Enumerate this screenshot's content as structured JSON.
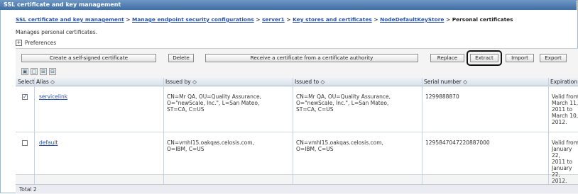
{
  "window": {
    "title": "SSL certificate and key management"
  },
  "breadcrumb": {
    "items": [
      "SSL certificate and key management",
      "Manage endpoint security configurations",
      "server1",
      "Key stores and certificates",
      "NodeDefaultKeyStore"
    ],
    "separator": ">",
    "current": "Personal certificates"
  },
  "description": "Manages personal certificates.",
  "preferences": {
    "label": "Preferences",
    "toggle": "+"
  },
  "toolbar": {
    "create": "Create a self-signed certificate",
    "delete": "Delete",
    "receive": "Receive a certificate from a certificate authority",
    "replace": "Replace",
    "extract": "Extract",
    "import": "Import",
    "export": "Export"
  },
  "table": {
    "headers": {
      "select": "Select",
      "alias": "Alias ◇",
      "issued_by": "Issued by ◇",
      "issued_to": "Issued to ◇",
      "serial": "Serial number ◇",
      "expiration": "Expiration ◇"
    },
    "rows": [
      {
        "checked": true,
        "alias": "servicelink",
        "issued_by": "CN=Mr QA, OU=Quality Assurance,\nO=\"newScale, Inc.\", L=San Mateo,\nST=CA, C=US",
        "issued_to": "CN=Mr QA, OU=Quality Assurance,\nO=\"newScale, Inc.\", L=San Mateo,\nST=CA, C=US",
        "serial": "1299888870",
        "expiration": "Valid from\nMarch 11,\n2011 to\nMarch 10,\n2012."
      },
      {
        "checked": false,
        "alias": "default",
        "issued_by": "CN=vmhl15.oakqas.celosis.com,\nO=IBM, C=US",
        "issued_to": "CN=vmhl15.oakqas.celosis.com,\nO=IBM, C=US",
        "serial": "1295847047220887000",
        "expiration": "Valid from\nJanuary 22,\n2011 to\nJanuary 22,\n2012."
      }
    ],
    "total": "Total 2"
  }
}
